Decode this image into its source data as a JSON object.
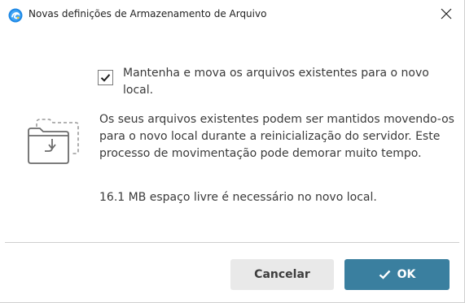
{
  "window": {
    "title": "Novas definições de Armazenamento de Arquivo",
    "app_icon": "app-logo-icon",
    "close_icon": "close-icon"
  },
  "content": {
    "icon": "folder-move-icon",
    "checkbox": {
      "checked": true,
      "label": "Mantenha e mova os arquivos existentes para o novo local."
    },
    "description": "Os seus arquivos existentes podem ser mantidos movendo-os para o novo local durante a reinicialização do servidor. Este processo de movimentação pode demorar muito tempo.",
    "space_note": "16.1 MB espaço livre é necessário no novo local."
  },
  "buttons": {
    "cancel_label": "Cancelar",
    "ok_label": "OK"
  },
  "colors": {
    "ok_button": "#3a7f9f",
    "cancel_button": "#e9e9e9",
    "app_icon_accent": "#1e88e5"
  }
}
